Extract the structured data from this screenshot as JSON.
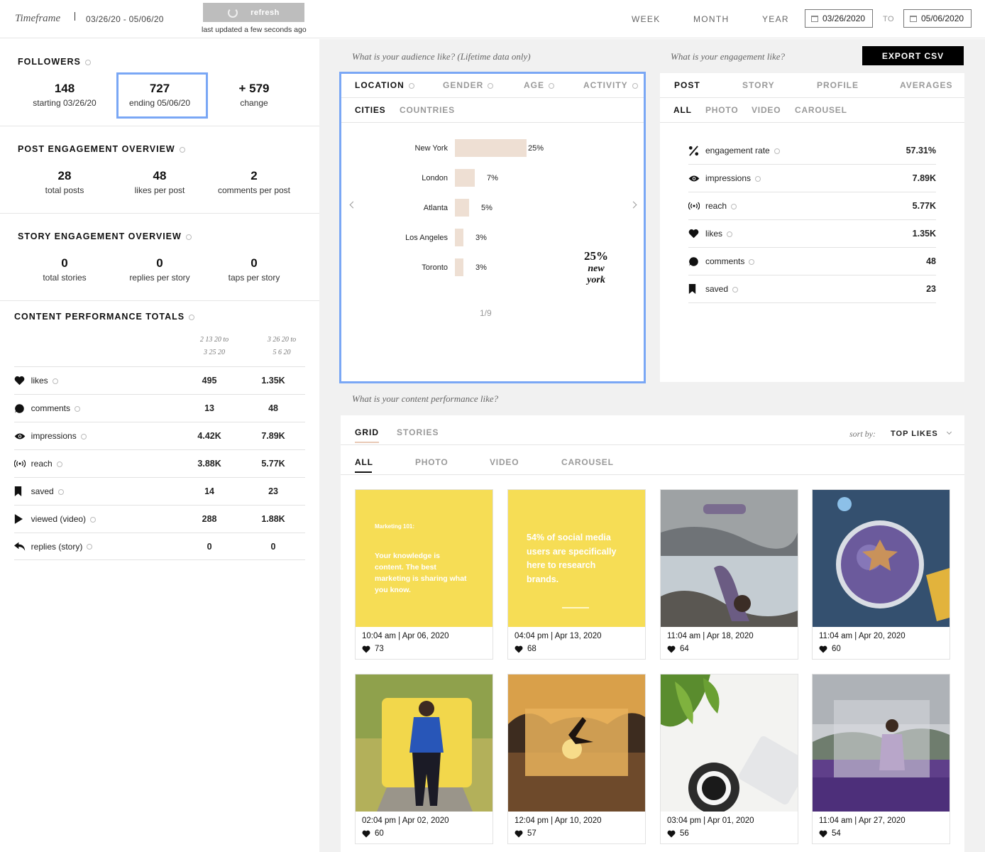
{
  "topbar": {
    "timeframe_label": "Timeframe",
    "timeframe_range": "03/26/20 - 05/06/20",
    "refresh_label": "refresh",
    "last_updated": "last updated a few seconds ago",
    "ranges": [
      "WEEK",
      "MONTH",
      "YEAR"
    ],
    "date_from": "03/26/2020",
    "to_label": "TO",
    "date_to": "05/06/2020"
  },
  "followers": {
    "title": "FOLLOWERS",
    "stats": [
      {
        "value": "148",
        "label": "starting 03/26/20"
      },
      {
        "value": "727",
        "label": "ending 05/06/20"
      },
      {
        "value": "+ 579",
        "label": "change"
      }
    ]
  },
  "post_engagement": {
    "title": "POST ENGAGEMENT OVERVIEW",
    "stats": [
      {
        "value": "28",
        "label": "total posts"
      },
      {
        "value": "48",
        "label": "likes per post"
      },
      {
        "value": "2",
        "label": "comments per post"
      }
    ]
  },
  "story_engagement": {
    "title": "STORY ENGAGEMENT OVERVIEW",
    "stats": [
      {
        "value": "0",
        "label": "total stories"
      },
      {
        "value": "0",
        "label": "replies per story"
      },
      {
        "value": "0",
        "label": "taps per story"
      }
    ]
  },
  "content_totals": {
    "title": "CONTENT PERFORMANCE TOTALS",
    "col1_line1": "2 13 20 to",
    "col1_line2": "3 25 20",
    "col2_line1": "3 26 20 to",
    "col2_line2": "5 6 20",
    "rows": [
      {
        "icon": "heart-icon",
        "label": "likes",
        "c1": "495",
        "c2": "1.35K"
      },
      {
        "icon": "comment-icon",
        "label": "comments",
        "c1": "13",
        "c2": "48"
      },
      {
        "icon": "eye-icon",
        "label": "impressions",
        "c1": "4.42K",
        "c2": "7.89K"
      },
      {
        "icon": "broadcast-icon",
        "label": "reach",
        "c1": "3.88K",
        "c2": "5.77K"
      },
      {
        "icon": "bookmark-icon",
        "label": "saved",
        "c1": "14",
        "c2": "23"
      },
      {
        "icon": "play-icon",
        "label": "viewed (video)",
        "c1": "288",
        "c2": "1.88K"
      },
      {
        "icon": "reply-icon",
        "label": "replies (story)",
        "c1": "0",
        "c2": "0"
      }
    ]
  },
  "audience": {
    "question": "What is your audience like? (Lifetime data only)",
    "tabs": [
      "LOCATION",
      "GENDER",
      "AGE",
      "ACTIVITY"
    ],
    "subtabs": [
      "CITIES",
      "COUNTRIES"
    ],
    "cities": [
      {
        "name": "New York",
        "pct": 25,
        "label": "25%"
      },
      {
        "name": "London",
        "pct": 7,
        "label": "7%"
      },
      {
        "name": "Atlanta",
        "pct": 5,
        "label": "5%"
      },
      {
        "name": "Los Angeles",
        "pct": 3,
        "label": "3%"
      },
      {
        "name": "Toronto",
        "pct": 3,
        "label": "3%"
      }
    ],
    "highlight_pct": "25%",
    "highlight_city_1": "new",
    "highlight_city_2": "york",
    "pager": "1/9"
  },
  "engagement": {
    "question": "What is your engagement like?",
    "export_label": "EXPORT CSV",
    "tabs": [
      "POST",
      "STORY",
      "PROFILE",
      "AVERAGES"
    ],
    "subtabs": [
      "ALL",
      "PHOTO",
      "VIDEO",
      "CAROUSEL"
    ],
    "rows": [
      {
        "icon": "percent-icon",
        "label": "engagement rate",
        "value": "57.31%"
      },
      {
        "icon": "eye-icon",
        "label": "impressions",
        "value": "7.89K"
      },
      {
        "icon": "broadcast-icon",
        "label": "reach",
        "value": "5.77K"
      },
      {
        "icon": "heart-icon",
        "label": "likes",
        "value": "1.35K"
      },
      {
        "icon": "comment-icon",
        "label": "comments",
        "value": "48"
      },
      {
        "icon": "bookmark-icon",
        "label": "saved",
        "value": "23"
      }
    ]
  },
  "content": {
    "question": "What is your content performance like?",
    "tabs": [
      "GRID",
      "STORIES"
    ],
    "sort_label": "sort by:",
    "sort_value": "TOP LIKES",
    "subtabs": [
      "ALL",
      "PHOTO",
      "VIDEO",
      "CAROUSEL"
    ],
    "posts": [
      {
        "meta": "10:04 am | Apr 06, 2020",
        "likes": "73",
        "kind": "yellow-text-1"
      },
      {
        "meta": "04:04 pm | Apr 13, 2020",
        "likes": "68",
        "kind": "yellow-text-2"
      },
      {
        "meta": "11:04 am | Apr 18, 2020",
        "likes": "64",
        "kind": "yoga"
      },
      {
        "meta": "11:04 am | Apr 20, 2020",
        "likes": "60",
        "kind": "bowl"
      },
      {
        "meta": "02:04 pm | Apr 02, 2020",
        "likes": "60",
        "kind": "runner"
      },
      {
        "meta": "12:04 pm | Apr 10, 2020",
        "likes": "57",
        "kind": "sunset"
      },
      {
        "meta": "03:04 pm | Apr 01, 2020",
        "likes": "56",
        "kind": "coffee"
      },
      {
        "meta": "11:04 am | Apr 27, 2020",
        "likes": "54",
        "kind": "field"
      }
    ],
    "post_text_1_title": "Marketing 101:",
    "post_text_1_body": "Your knowledge is content. The best marketing is sharing what you know.",
    "post_text_2_body": "54% of social media users are specifically here to research brands."
  },
  "colors": {
    "accent_outline": "#7aa7f5",
    "bar_fill": "#eedfd3",
    "yellow": "#f6dd55"
  }
}
